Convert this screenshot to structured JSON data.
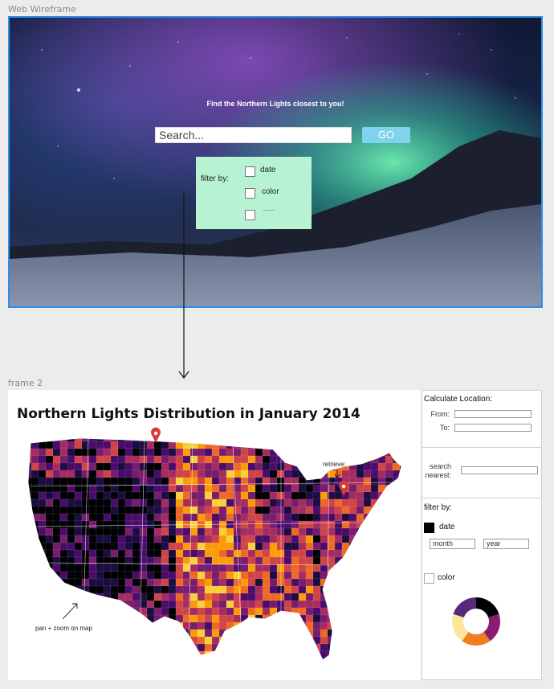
{
  "frame1": {
    "label": "Web Wireframe",
    "title": "Find the Northern Lights closest to you!",
    "search_placeholder": "Search...",
    "go_label": "GO",
    "filter": {
      "label": "filter by:",
      "options": [
        "date",
        "color",
        "........"
      ]
    }
  },
  "frame2": {
    "label": "frame 2",
    "title": "Northern Lights Distribution in January 2014",
    "annotations": {
      "retrieve": "retrieve:",
      "pan_zoom": "pan + zoom on map"
    }
  },
  "sidepanel": {
    "calc_title": "Calculate Location:",
    "from_label": "From:",
    "to_label": "To:",
    "search_nearest_line1": "search",
    "search_nearest_line2": "nearest:",
    "filter_title": "filter by:",
    "date_label": "date",
    "month_placeholder": "month",
    "year_placeholder": "year",
    "color_label": "color",
    "donut_colors": [
      "#000004",
      "#8a1d6e",
      "#f07d1f",
      "#fbe79c",
      "#5a2878"
    ]
  },
  "colors": {
    "frame_border": "#2f8fe6",
    "go_button": "#7fd3ec",
    "filter_box": "#b7f3d3",
    "pin": "#d63a3a"
  }
}
